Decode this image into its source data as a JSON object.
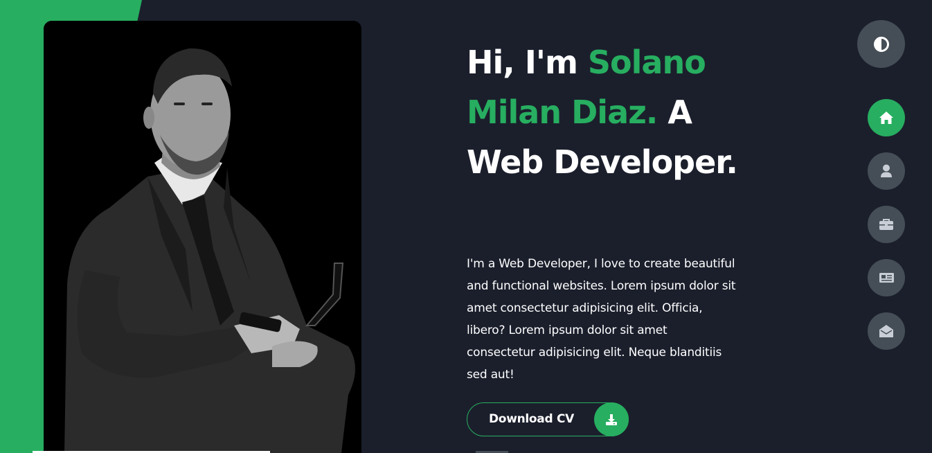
{
  "hero": {
    "greeting": "Hi, I'm ",
    "name": "Solano Milan Diaz.",
    "role": " A Web Developer.",
    "description": "I'm a Web Developer, I love to create beautiful and functional websites. Lorem ipsum dolor sit amet consectetur adipisicing elit. Officia, libero? Lorem ipsum dolor sit amet consectetur adipisicing elit. Neque blanditiis sed aut!",
    "download_label": "Download CV"
  },
  "nav": {
    "items": [
      {
        "icon": "home-icon",
        "active": true
      },
      {
        "icon": "user-icon",
        "active": false
      },
      {
        "icon": "briefcase-icon",
        "active": false
      },
      {
        "icon": "newspaper-icon",
        "active": false
      },
      {
        "icon": "envelope-open-icon",
        "active": false
      }
    ],
    "theme_toggle_icon": "adjust-icon"
  },
  "colors": {
    "accent": "#27ae60",
    "background": "#1b1f2c",
    "button_gray": "#454e56",
    "text": "#ffffff"
  }
}
